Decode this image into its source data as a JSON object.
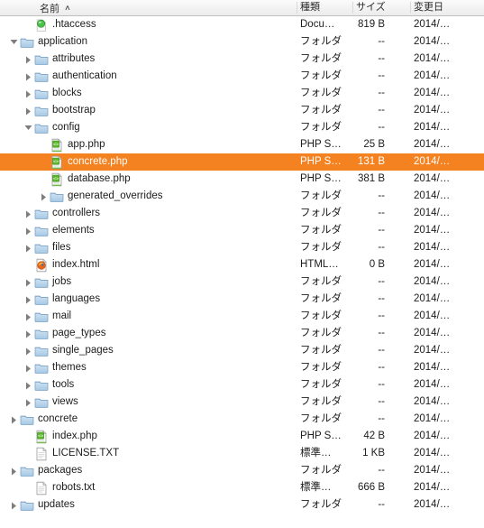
{
  "window": {
    "title": "Finder List View",
    "selection_color": "#f58220",
    "header_text_color": "#2b2b2b",
    "row_text_color": "#1c1c1c"
  },
  "columns": {
    "name": {
      "label": "名前",
      "sort_indicator": "∧"
    },
    "kind": {
      "label": "種類"
    },
    "size": {
      "label": "サイズ"
    },
    "date": {
      "label": "変更日"
    }
  },
  "rows": [
    {
      "name": ".htaccess",
      "kind": "Docu…",
      "size": "819 B",
      "date": "2014/…",
      "icon": "htaccess-icon",
      "depth": 1,
      "twisty": "none",
      "selected": false
    },
    {
      "name": "application",
      "kind": "フォルダ",
      "size": "--",
      "date": "2014/…",
      "icon": "folder-icon",
      "depth": 0,
      "twisty": "open",
      "selected": false
    },
    {
      "name": "attributes",
      "kind": "フォルダ",
      "size": "--",
      "date": "2014/…",
      "icon": "folder-icon",
      "depth": 1,
      "twisty": "closed",
      "selected": false
    },
    {
      "name": "authentication",
      "kind": "フォルダ",
      "size": "--",
      "date": "2014/…",
      "icon": "folder-icon",
      "depth": 1,
      "twisty": "closed",
      "selected": false
    },
    {
      "name": "blocks",
      "kind": "フォルダ",
      "size": "--",
      "date": "2014/…",
      "icon": "folder-icon",
      "depth": 1,
      "twisty": "closed",
      "selected": false
    },
    {
      "name": "bootstrap",
      "kind": "フォルダ",
      "size": "--",
      "date": "2014/…",
      "icon": "folder-icon",
      "depth": 1,
      "twisty": "closed",
      "selected": false
    },
    {
      "name": "config",
      "kind": "フォルダ",
      "size": "--",
      "date": "2014/…",
      "icon": "folder-icon",
      "depth": 1,
      "twisty": "open",
      "selected": false
    },
    {
      "name": "app.php",
      "kind": "PHP S…",
      "size": "25 B",
      "date": "2014/…",
      "icon": "php-file-icon",
      "depth": 2,
      "twisty": "none",
      "selected": false
    },
    {
      "name": "concrete.php",
      "kind": "PHP S…",
      "size": "131 B",
      "date": "2014/…",
      "icon": "php-file-icon",
      "depth": 2,
      "twisty": "none",
      "selected": true
    },
    {
      "name": "database.php",
      "kind": "PHP S…",
      "size": "381 B",
      "date": "2014/…",
      "icon": "php-file-icon",
      "depth": 2,
      "twisty": "none",
      "selected": false
    },
    {
      "name": "generated_overrides",
      "kind": "フォルダ",
      "size": "--",
      "date": "2014/…",
      "icon": "folder-icon",
      "depth": 2,
      "twisty": "closed",
      "selected": false
    },
    {
      "name": "controllers",
      "kind": "フォルダ",
      "size": "--",
      "date": "2014/…",
      "icon": "folder-icon",
      "depth": 1,
      "twisty": "closed",
      "selected": false
    },
    {
      "name": "elements",
      "kind": "フォルダ",
      "size": "--",
      "date": "2014/…",
      "icon": "folder-icon",
      "depth": 1,
      "twisty": "closed",
      "selected": false
    },
    {
      "name": "files",
      "kind": "フォルダ",
      "size": "--",
      "date": "2014/…",
      "icon": "folder-icon",
      "depth": 1,
      "twisty": "closed",
      "selected": false
    },
    {
      "name": "index.html",
      "kind": "HTML…",
      "size": "0 B",
      "date": "2014/…",
      "icon": "firefox-html-icon",
      "depth": 1,
      "twisty": "none",
      "selected": false
    },
    {
      "name": "jobs",
      "kind": "フォルダ",
      "size": "--",
      "date": "2014/…",
      "icon": "folder-icon",
      "depth": 1,
      "twisty": "closed",
      "selected": false
    },
    {
      "name": "languages",
      "kind": "フォルダ",
      "size": "--",
      "date": "2014/…",
      "icon": "folder-icon",
      "depth": 1,
      "twisty": "closed",
      "selected": false
    },
    {
      "name": "mail",
      "kind": "フォルダ",
      "size": "--",
      "date": "2014/…",
      "icon": "folder-icon",
      "depth": 1,
      "twisty": "closed",
      "selected": false
    },
    {
      "name": "page_types",
      "kind": "フォルダ",
      "size": "--",
      "date": "2014/…",
      "icon": "folder-icon",
      "depth": 1,
      "twisty": "closed",
      "selected": false
    },
    {
      "name": "single_pages",
      "kind": "フォルダ",
      "size": "--",
      "date": "2014/…",
      "icon": "folder-icon",
      "depth": 1,
      "twisty": "closed",
      "selected": false
    },
    {
      "name": "themes",
      "kind": "フォルダ",
      "size": "--",
      "date": "2014/…",
      "icon": "folder-icon",
      "depth": 1,
      "twisty": "closed",
      "selected": false
    },
    {
      "name": "tools",
      "kind": "フォルダ",
      "size": "--",
      "date": "2014/…",
      "icon": "folder-icon",
      "depth": 1,
      "twisty": "closed",
      "selected": false
    },
    {
      "name": "views",
      "kind": "フォルダ",
      "size": "--",
      "date": "2014/…",
      "icon": "folder-icon",
      "depth": 1,
      "twisty": "closed",
      "selected": false
    },
    {
      "name": "concrete",
      "kind": "フォルダ",
      "size": "--",
      "date": "2014/…",
      "icon": "folder-icon",
      "depth": 0,
      "twisty": "closed",
      "selected": false
    },
    {
      "name": "index.php",
      "kind": "PHP S…",
      "size": "42 B",
      "date": "2014/…",
      "icon": "php-file-icon",
      "depth": 1,
      "twisty": "none",
      "selected": false
    },
    {
      "name": "LICENSE.TXT",
      "kind": "標準…",
      "size": "1 KB",
      "date": "2014/…",
      "icon": "text-file-icon",
      "depth": 1,
      "twisty": "none",
      "selected": false
    },
    {
      "name": "packages",
      "kind": "フォルダ",
      "size": "--",
      "date": "2014/…",
      "icon": "folder-icon",
      "depth": 0,
      "twisty": "closed",
      "selected": false
    },
    {
      "name": "robots.txt",
      "kind": "標準…",
      "size": "666 B",
      "date": "2014/…",
      "icon": "text-file-icon",
      "depth": 1,
      "twisty": "none",
      "selected": false
    },
    {
      "name": "updates",
      "kind": "フォルダ",
      "size": "--",
      "date": "2014/…",
      "icon": "folder-icon",
      "depth": 0,
      "twisty": "closed",
      "selected": false
    }
  ]
}
